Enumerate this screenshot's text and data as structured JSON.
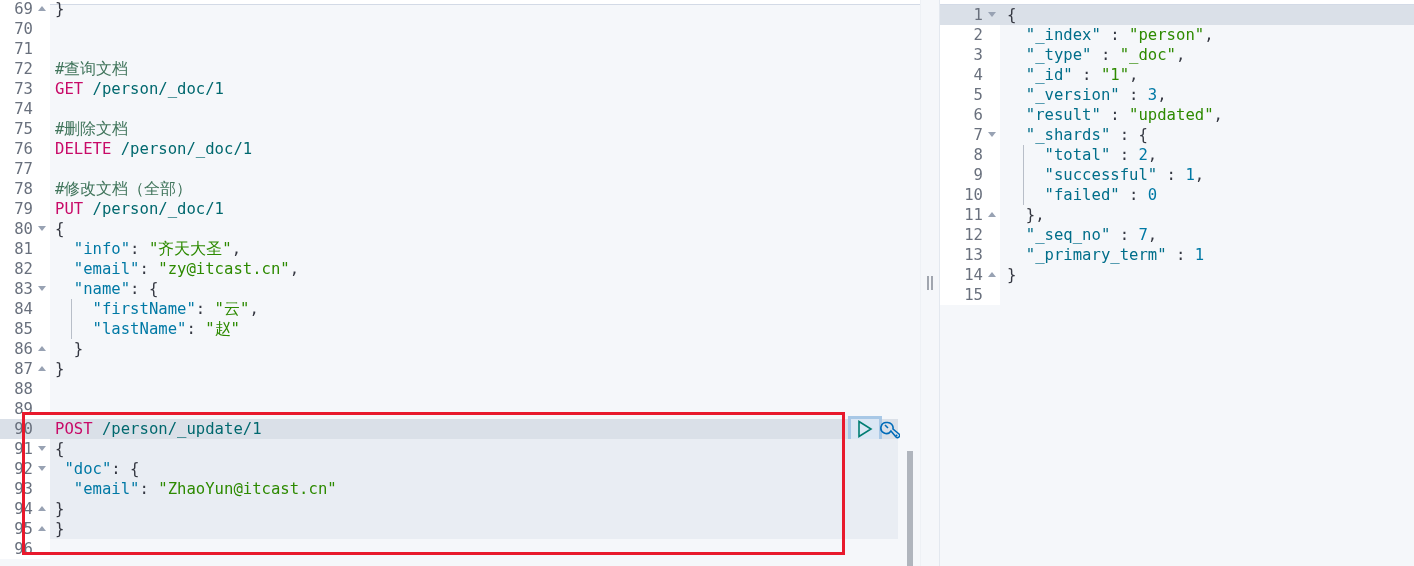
{
  "request_editor": {
    "lines": [
      {
        "number": "69",
        "fold_start": false,
        "fold_end": true,
        "active": false,
        "in_request": false,
        "guide": false,
        "tokens": [
          {
            "kind": "punct",
            "text": "}"
          }
        ]
      },
      {
        "number": "70",
        "fold_start": false,
        "fold_end": false,
        "active": false,
        "in_request": false,
        "guide": false
      },
      {
        "number": "71",
        "fold_start": false,
        "fold_end": false,
        "active": false,
        "in_request": false,
        "guide": false
      },
      {
        "number": "72",
        "fold_start": false,
        "fold_end": false,
        "active": false,
        "in_request": false,
        "guide": false,
        "tokens": [
          {
            "kind": "comment",
            "text": "#查询文档"
          }
        ]
      },
      {
        "number": "73",
        "fold_start": false,
        "fold_end": false,
        "active": false,
        "in_request": false,
        "guide": false,
        "tokens": [
          {
            "kind": "method",
            "text": "GET"
          },
          {
            "kind": "path",
            "text": " /person/_doc/1"
          }
        ]
      },
      {
        "number": "74",
        "fold_start": false,
        "fold_end": false,
        "active": false,
        "in_request": false,
        "guide": false
      },
      {
        "number": "75",
        "fold_start": false,
        "fold_end": false,
        "active": false,
        "in_request": false,
        "guide": false,
        "tokens": [
          {
            "kind": "comment",
            "text": "#删除文档"
          }
        ]
      },
      {
        "number": "76",
        "fold_start": false,
        "fold_end": false,
        "active": false,
        "in_request": false,
        "guide": false,
        "tokens": [
          {
            "kind": "method",
            "text": "DELETE"
          },
          {
            "kind": "path",
            "text": " /person/_doc/1"
          }
        ]
      },
      {
        "number": "77",
        "fold_start": false,
        "fold_end": false,
        "active": false,
        "in_request": false,
        "guide": false
      },
      {
        "number": "78",
        "fold_start": false,
        "fold_end": false,
        "active": false,
        "in_request": false,
        "guide": false,
        "tokens": [
          {
            "kind": "comment",
            "text": "#修改文档（全部）"
          }
        ]
      },
      {
        "number": "79",
        "fold_start": false,
        "fold_end": false,
        "active": false,
        "in_request": false,
        "guide": false,
        "tokens": [
          {
            "kind": "method",
            "text": "PUT"
          },
          {
            "kind": "path",
            "text": " /person/_doc/1"
          }
        ]
      },
      {
        "number": "80",
        "fold_start": true,
        "fold_end": false,
        "active": false,
        "in_request": false,
        "guide": false,
        "tokens": [
          {
            "kind": "punct",
            "text": "{"
          }
        ]
      },
      {
        "number": "81",
        "fold_start": false,
        "fold_end": false,
        "active": false,
        "in_request": false,
        "guide": false,
        "tokens": [
          {
            "kind": "key",
            "text": "  \"info\""
          },
          {
            "kind": "punct",
            "text": ": "
          },
          {
            "kind": "string",
            "text": "\"齐天大圣\""
          },
          {
            "kind": "punct",
            "text": ","
          }
        ]
      },
      {
        "number": "82",
        "fold_start": false,
        "fold_end": false,
        "active": false,
        "in_request": false,
        "guide": false,
        "tokens": [
          {
            "kind": "key",
            "text": "  \"email\""
          },
          {
            "kind": "punct",
            "text": ": "
          },
          {
            "kind": "string",
            "text": "\"zy@itcast.cn\""
          },
          {
            "kind": "punct",
            "text": ","
          }
        ]
      },
      {
        "number": "83",
        "fold_start": true,
        "fold_end": false,
        "active": false,
        "in_request": false,
        "guide": false,
        "tokens": [
          {
            "kind": "key",
            "text": "  \"name\""
          },
          {
            "kind": "punct",
            "text": ": {"
          }
        ]
      },
      {
        "number": "84",
        "fold_start": false,
        "fold_end": false,
        "active": false,
        "in_request": false,
        "guide": true,
        "tokens": [
          {
            "kind": "key",
            "text": "    \"firstName\""
          },
          {
            "kind": "punct",
            "text": ": "
          },
          {
            "kind": "string",
            "text": "\"云\""
          },
          {
            "kind": "punct",
            "text": ","
          }
        ]
      },
      {
        "number": "85",
        "fold_start": false,
        "fold_end": false,
        "active": false,
        "in_request": false,
        "guide": true,
        "tokens": [
          {
            "kind": "key",
            "text": "    \"lastName\""
          },
          {
            "kind": "punct",
            "text": ": "
          },
          {
            "kind": "string",
            "text": "\"赵\""
          }
        ]
      },
      {
        "number": "86",
        "fold_start": false,
        "fold_end": true,
        "active": false,
        "in_request": false,
        "guide": false,
        "tokens": [
          {
            "kind": "punct",
            "text": "  }"
          }
        ]
      },
      {
        "number": "87",
        "fold_start": false,
        "fold_end": true,
        "active": false,
        "in_request": false,
        "guide": false,
        "tokens": [
          {
            "kind": "punct",
            "text": "}"
          }
        ]
      },
      {
        "number": "88",
        "fold_start": false,
        "fold_end": false,
        "active": false,
        "in_request": false,
        "guide": false
      },
      {
        "number": "89",
        "fold_start": false,
        "fold_end": false,
        "active": false,
        "in_request": false,
        "guide": false
      },
      {
        "number": "90",
        "fold_start": false,
        "fold_end": false,
        "active": true,
        "in_request": true,
        "guide": false,
        "tokens": [
          {
            "kind": "method",
            "text": "POST"
          },
          {
            "kind": "path",
            "text": " /person/_update/1"
          }
        ]
      },
      {
        "number": "91",
        "fold_start": true,
        "fold_end": false,
        "active": false,
        "in_request": true,
        "guide": false,
        "tokens": [
          {
            "kind": "punct",
            "text": "{"
          }
        ]
      },
      {
        "number": "92",
        "fold_start": true,
        "fold_end": false,
        "active": false,
        "in_request": true,
        "guide": false,
        "tokens": [
          {
            "kind": "key",
            "text": " \"doc\""
          },
          {
            "kind": "punct",
            "text": ": {"
          }
        ]
      },
      {
        "number": "93",
        "fold_start": false,
        "fold_end": false,
        "active": false,
        "in_request": true,
        "guide": false,
        "tokens": [
          {
            "kind": "key",
            "text": "  \"email\""
          },
          {
            "kind": "punct",
            "text": ": "
          },
          {
            "kind": "string",
            "text": "\"ZhaoYun@itcast.cn\""
          }
        ]
      },
      {
        "number": "94",
        "fold_start": false,
        "fold_end": true,
        "active": false,
        "in_request": true,
        "guide": false,
        "tokens": [
          {
            "kind": "punct",
            "text": "}"
          }
        ]
      },
      {
        "number": "95",
        "fold_start": false,
        "fold_end": true,
        "active": false,
        "in_request": true,
        "guide": false,
        "tokens": [
          {
            "kind": "punct",
            "text": "}"
          }
        ]
      },
      {
        "number": "96",
        "fold_start": false,
        "fold_end": false,
        "active": false,
        "in_request": false,
        "guide": false
      }
    ]
  },
  "response_panel": {
    "lines": [
      {
        "number": "1",
        "fold_start": true,
        "fold_end": false,
        "active": true,
        "guide": false,
        "tokens": [
          {
            "kind": "punct",
            "text": "{"
          }
        ]
      },
      {
        "number": "2",
        "fold_start": false,
        "fold_end": false,
        "active": false,
        "guide": false,
        "tokens": [
          {
            "kind": "key",
            "text": "  \"_index\""
          },
          {
            "kind": "punct",
            "text": " : "
          },
          {
            "kind": "string",
            "text": "\"person\""
          },
          {
            "kind": "punct",
            "text": ","
          }
        ]
      },
      {
        "number": "3",
        "fold_start": false,
        "fold_end": false,
        "active": false,
        "guide": false,
        "tokens": [
          {
            "kind": "key",
            "text": "  \"_type\""
          },
          {
            "kind": "punct",
            "text": " : "
          },
          {
            "kind": "string",
            "text": "\"_doc\""
          },
          {
            "kind": "punct",
            "text": ","
          }
        ]
      },
      {
        "number": "4",
        "fold_start": false,
        "fold_end": false,
        "active": false,
        "guide": false,
        "tokens": [
          {
            "kind": "key",
            "text": "  \"_id\""
          },
          {
            "kind": "punct",
            "text": " : "
          },
          {
            "kind": "string",
            "text": "\"1\""
          },
          {
            "kind": "punct",
            "text": ","
          }
        ]
      },
      {
        "number": "5",
        "fold_start": false,
        "fold_end": false,
        "active": false,
        "guide": false,
        "tokens": [
          {
            "kind": "key",
            "text": "  \"_version\""
          },
          {
            "kind": "punct",
            "text": " : "
          },
          {
            "kind": "number",
            "text": "3"
          },
          {
            "kind": "punct",
            "text": ","
          }
        ]
      },
      {
        "number": "6",
        "fold_start": false,
        "fold_end": false,
        "active": false,
        "guide": false,
        "tokens": [
          {
            "kind": "key",
            "text": "  \"result\""
          },
          {
            "kind": "punct",
            "text": " : "
          },
          {
            "kind": "string",
            "text": "\"updated\""
          },
          {
            "kind": "punct",
            "text": ","
          }
        ]
      },
      {
        "number": "7",
        "fold_start": true,
        "fold_end": false,
        "active": false,
        "guide": false,
        "tokens": [
          {
            "kind": "key",
            "text": "  \"_shards\""
          },
          {
            "kind": "punct",
            "text": " : {"
          }
        ]
      },
      {
        "number": "8",
        "fold_start": false,
        "fold_end": false,
        "active": false,
        "guide": true,
        "tokens": [
          {
            "kind": "key",
            "text": "    \"total\""
          },
          {
            "kind": "punct",
            "text": " : "
          },
          {
            "kind": "number",
            "text": "2"
          },
          {
            "kind": "punct",
            "text": ","
          }
        ]
      },
      {
        "number": "9",
        "fold_start": false,
        "fold_end": false,
        "active": false,
        "guide": true,
        "tokens": [
          {
            "kind": "key",
            "text": "    \"successful\""
          },
          {
            "kind": "punct",
            "text": " : "
          },
          {
            "kind": "number",
            "text": "1"
          },
          {
            "kind": "punct",
            "text": ","
          }
        ]
      },
      {
        "number": "10",
        "fold_start": false,
        "fold_end": false,
        "active": false,
        "guide": true,
        "tokens": [
          {
            "kind": "key",
            "text": "    \"failed\""
          },
          {
            "kind": "punct",
            "text": " : "
          },
          {
            "kind": "number",
            "text": "0"
          }
        ]
      },
      {
        "number": "11",
        "fold_start": false,
        "fold_end": true,
        "active": false,
        "guide": false,
        "tokens": [
          {
            "kind": "punct",
            "text": "  },"
          }
        ]
      },
      {
        "number": "12",
        "fold_start": false,
        "fold_end": false,
        "active": false,
        "guide": false,
        "tokens": [
          {
            "kind": "key",
            "text": "  \"_seq_no\""
          },
          {
            "kind": "punct",
            "text": " : "
          },
          {
            "kind": "number",
            "text": "7"
          },
          {
            "kind": "punct",
            "text": ","
          }
        ]
      },
      {
        "number": "13",
        "fold_start": false,
        "fold_end": false,
        "active": false,
        "guide": false,
        "tokens": [
          {
            "kind": "key",
            "text": "  \"_primary_term\""
          },
          {
            "kind": "punct",
            "text": " : "
          },
          {
            "kind": "number",
            "text": "1"
          }
        ]
      },
      {
        "number": "14",
        "fold_start": false,
        "fold_end": true,
        "active": false,
        "guide": false,
        "tokens": [
          {
            "kind": "punct",
            "text": "}"
          }
        ]
      },
      {
        "number": "15",
        "fold_start": false,
        "fold_end": false,
        "active": false,
        "guide": false
      }
    ]
  }
}
